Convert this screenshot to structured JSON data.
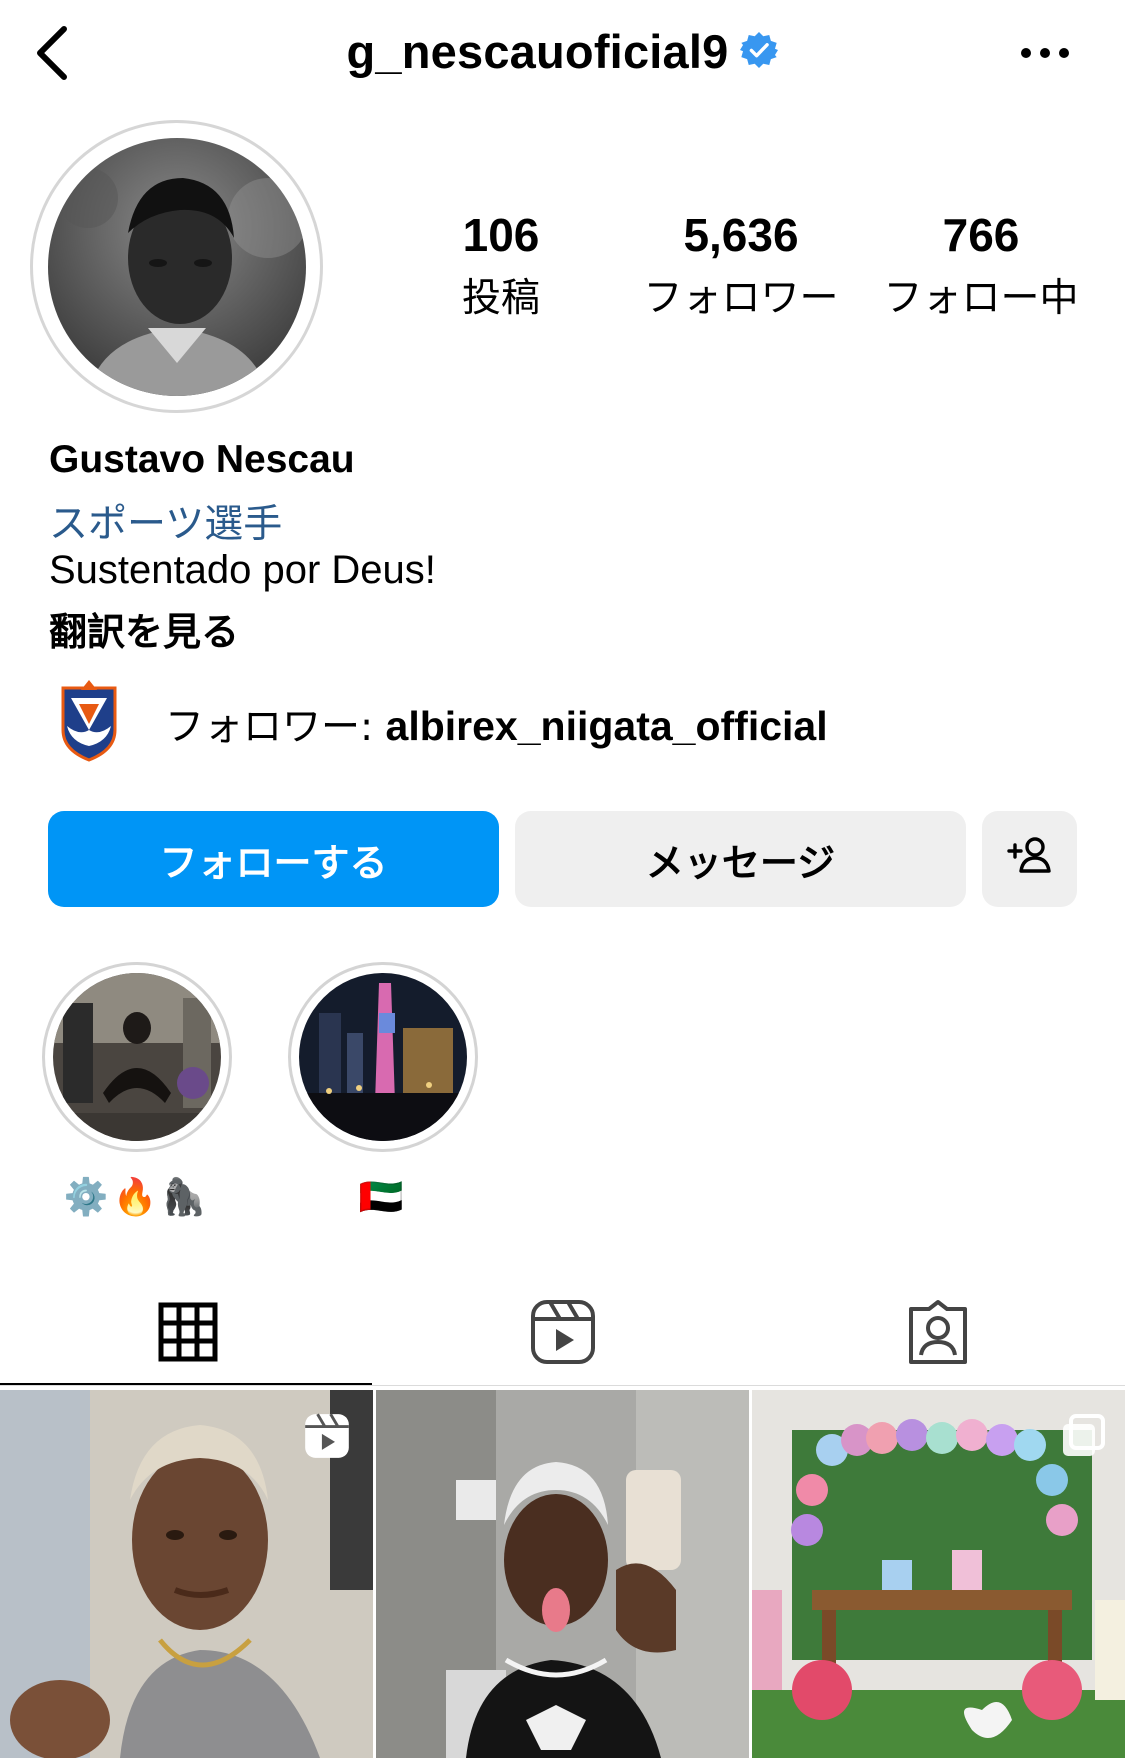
{
  "header": {
    "username": "g_nescauoficial9",
    "back_icon": "chevron-left-icon",
    "verified_icon": "verified-badge-icon",
    "more_icon": "more-horizontal-icon"
  },
  "profile": {
    "stats": [
      {
        "value": "106",
        "label": "投稿"
      },
      {
        "value": "5,636",
        "label": "フォロワー"
      },
      {
        "value": "766",
        "label": "フォロー中"
      }
    ],
    "name": "Gustavo Nescau",
    "category": "スポーツ選手",
    "bio": "Sustentado por Deus!",
    "translate": "翻訳を見る",
    "followed_by_prefix": "フォロワー: ",
    "followed_by_account": "albirex_niigata_official"
  },
  "actions": {
    "follow_label": "フォローする",
    "message_label": "メッセージ",
    "add_user_icon": "add-person-icon"
  },
  "highlights": [
    {
      "label": "⚙️🔥🦍"
    },
    {
      "label": "🇦🇪"
    }
  ],
  "tabs": [
    {
      "icon": "grid-icon",
      "active": true
    },
    {
      "icon": "reels-icon",
      "active": false
    },
    {
      "icon": "tagged-icon",
      "active": false
    }
  ],
  "colors": {
    "accent": "#0095f6",
    "category_link": "#2a5a8c",
    "verified": "#3897f0",
    "button_gray": "#efefef"
  }
}
